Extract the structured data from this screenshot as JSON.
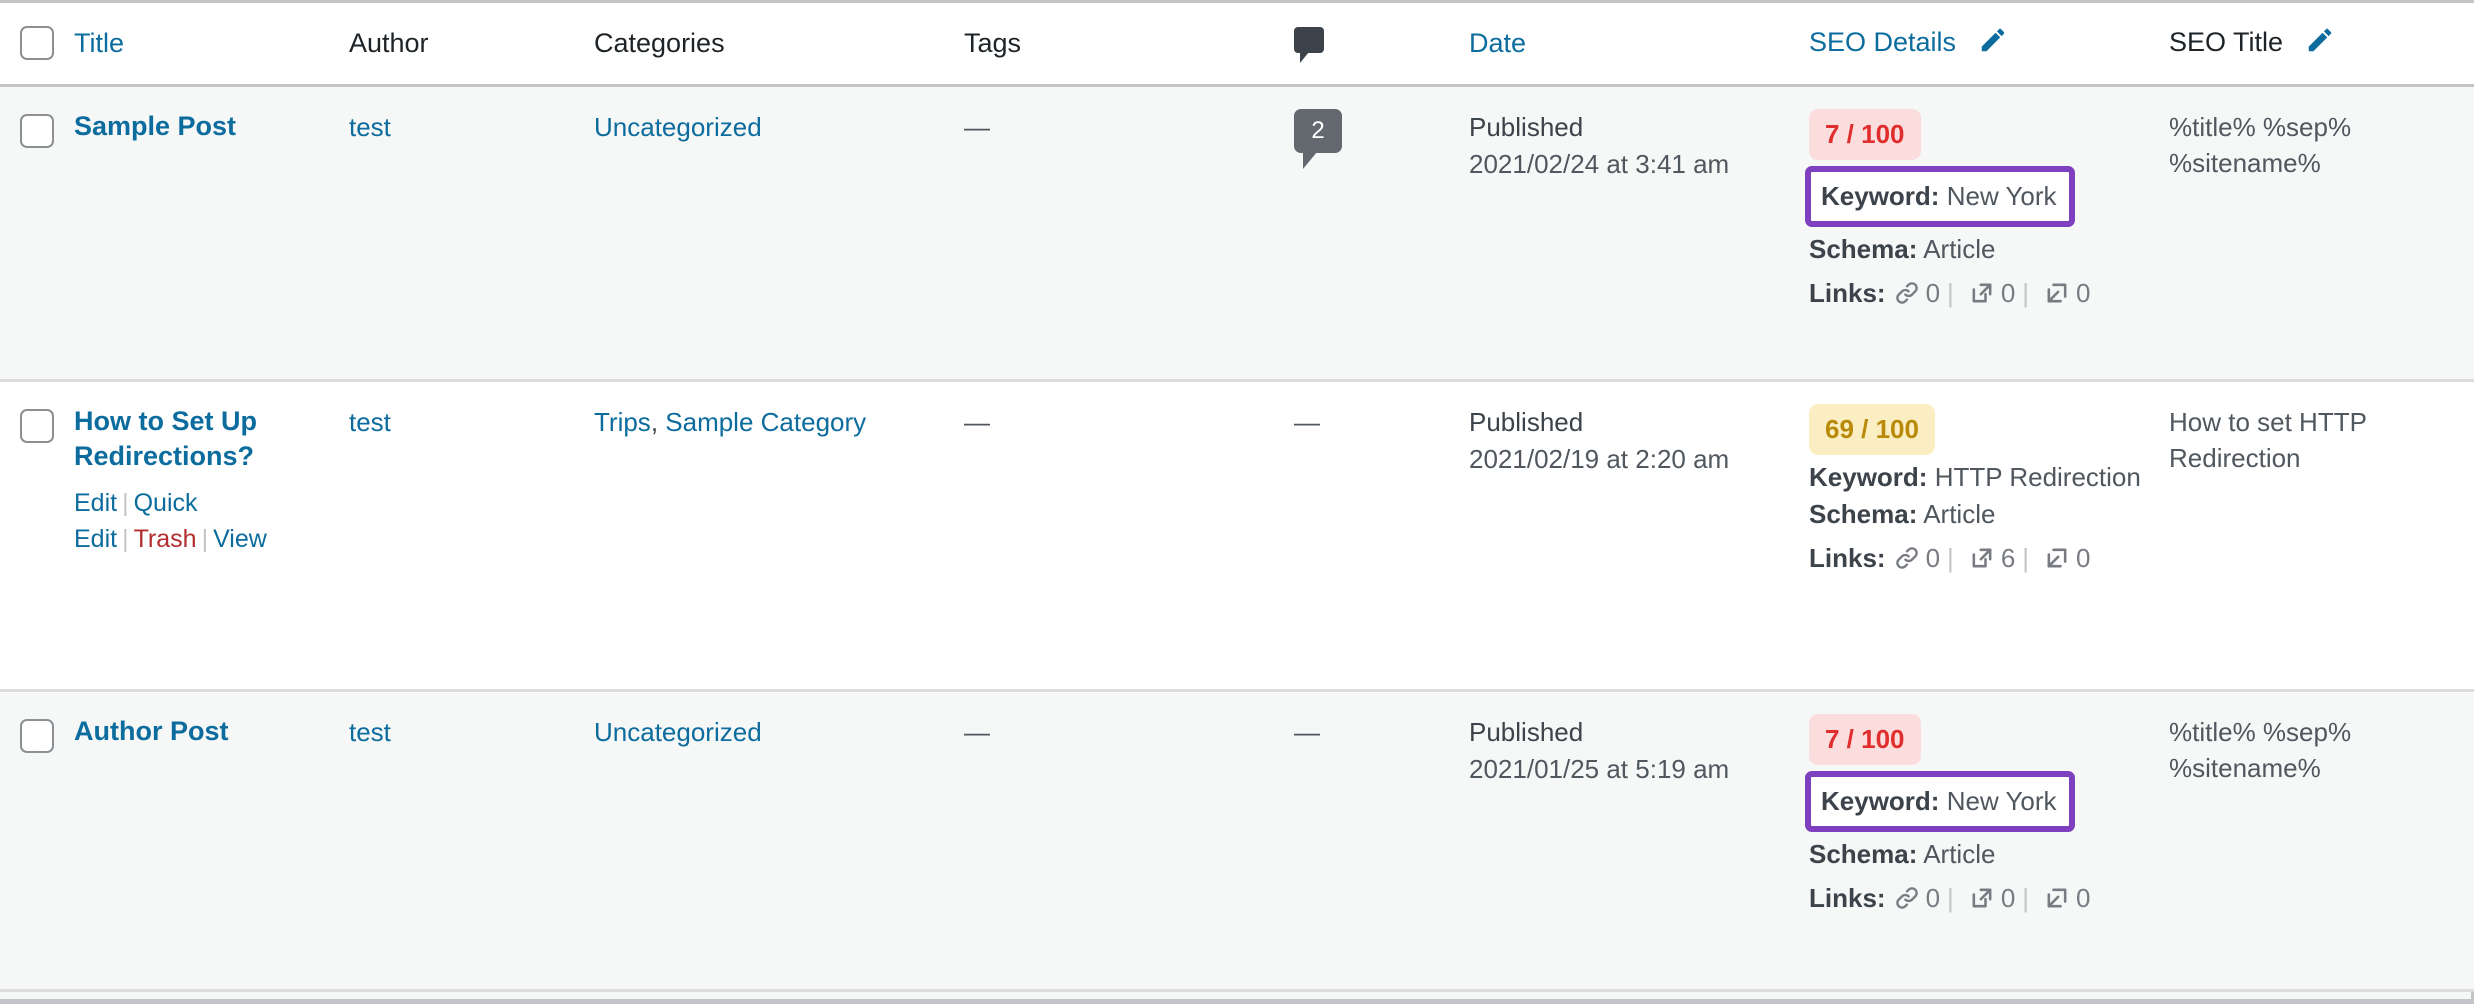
{
  "table": {
    "columns": [
      {
        "key": "cb",
        "label": "",
        "icon": "select-all-checkbox",
        "link": false
      },
      {
        "key": "title",
        "label": "Title",
        "link": true
      },
      {
        "key": "author",
        "label": "Author",
        "link": false
      },
      {
        "key": "categories",
        "label": "Categories",
        "link": false
      },
      {
        "key": "tags",
        "label": "Tags",
        "link": false
      },
      {
        "key": "comments",
        "label": "",
        "icon": "comment-bubble-icon",
        "link": false
      },
      {
        "key": "date",
        "label": "Date",
        "link": true
      },
      {
        "key": "seo",
        "label": "SEO Details",
        "link": true,
        "icon": "pencil-icon"
      },
      {
        "key": "seotitle",
        "label": "SEO Title",
        "link": false,
        "icon": "pencil-icon"
      }
    ],
    "labels": {
      "title": "Title",
      "author": "Author",
      "categories": "Categories",
      "tags": "Tags",
      "date": "Date",
      "seo_details": "SEO Details",
      "seo_title": "SEO Title"
    },
    "rows": [
      {
        "checked": false,
        "hovered": false,
        "title": "Sample Post",
        "author": "test",
        "categories": [
          "Uncategorized"
        ],
        "tags": "—",
        "comments": "2",
        "comments_dash": null,
        "date_status": "Published",
        "date_value": "2021/02/24 at 3:41 am",
        "seo": {
          "score": "7 / 100",
          "score_state": "bad",
          "keyword_label": "Keyword:",
          "keyword_value": "New York",
          "keyword_highlighted": true,
          "schema_label": "Schema:",
          "schema_value": "Article",
          "links_label": "Links:",
          "internal_links": "0",
          "external_links": "0",
          "incoming_links": "0"
        },
        "seo_title": "%title% %sep% %sitename%"
      },
      {
        "checked": false,
        "hovered": true,
        "title": "How to Set Up Redirections?",
        "author": "test",
        "categories": [
          "Trips",
          "Sample Category"
        ],
        "tags": "—",
        "comments": null,
        "comments_dash": "—",
        "date_status": "Published",
        "date_value": "2021/02/19 at 2:20 am",
        "row_actions": [
          {
            "label": "Edit",
            "style": "link"
          },
          {
            "label": "Quick Edit",
            "style": "link"
          },
          {
            "label": "Trash",
            "style": "trash"
          },
          {
            "label": "View",
            "style": "link"
          }
        ],
        "seo": {
          "score": "69 / 100",
          "score_state": "ok",
          "keyword_label": "Keyword:",
          "keyword_value": "HTTP Redirection",
          "keyword_highlighted": false,
          "schema_label": "Schema:",
          "schema_value": "Article",
          "links_label": "Links:",
          "internal_links": "0",
          "external_links": "6",
          "incoming_links": "0"
        },
        "seo_title": "How to set HTTP Redirection"
      },
      {
        "checked": false,
        "hovered": false,
        "title": "Author Post",
        "author": "test",
        "categories": [
          "Uncategorized"
        ],
        "tags": "—",
        "comments": null,
        "comments_dash": "—",
        "date_status": "Published",
        "date_value": "2021/01/25 at 5:19 am",
        "seo": {
          "score": "7 / 100",
          "score_state": "bad",
          "keyword_label": "Keyword:",
          "keyword_value": "New York",
          "keyword_highlighted": true,
          "schema_label": "Schema:",
          "schema_value": "Article",
          "links_label": "Links:",
          "internal_links": "0",
          "external_links": "0",
          "incoming_links": "0"
        },
        "seo_title": "%title% %sep% %sitename%"
      }
    ]
  },
  "colors": {
    "link": "#0d6c9e",
    "trash": "#b32d2e",
    "score_bad_bg": "#fbdddd",
    "score_bad_fg": "#e02d2d",
    "score_ok_bg": "#fbeec2",
    "score_ok_fg": "#b98a08",
    "highlight_purple": "#7f40bf",
    "row_alt_bg": "#f6f7f7",
    "row_hover_bg": "#ffffff",
    "border": "#c3c4c7"
  }
}
